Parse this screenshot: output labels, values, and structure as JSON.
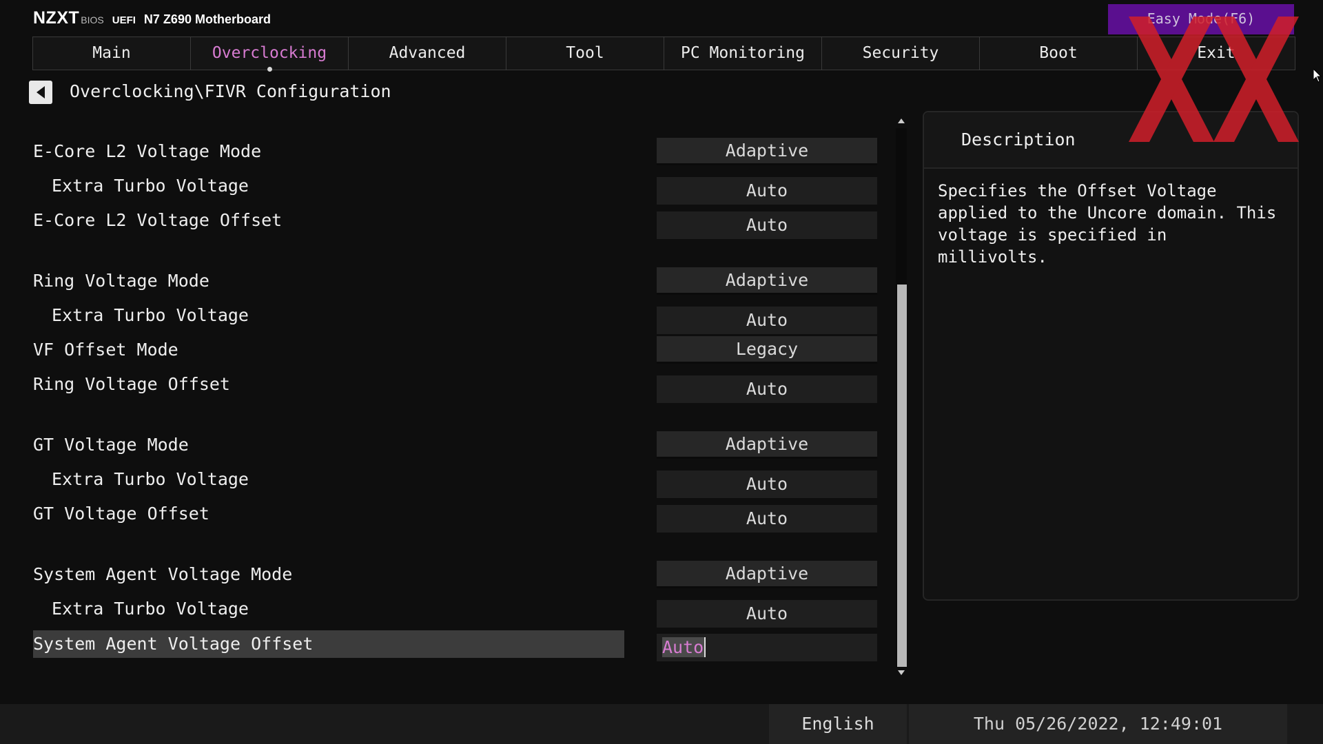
{
  "header": {
    "logo": "NZXT",
    "bios_label": "BIOS",
    "uefi_label": "UEFI",
    "board_name": "N7 Z690 Motherboard",
    "easy_mode": "Easy Mode(F6)"
  },
  "tabs": [
    {
      "label": "Main"
    },
    {
      "label": "Overclocking",
      "active": true
    },
    {
      "label": "Advanced"
    },
    {
      "label": "Tool"
    },
    {
      "label": "PC Monitoring"
    },
    {
      "label": "Security"
    },
    {
      "label": "Boot"
    },
    {
      "label": "Exit"
    }
  ],
  "breadcrumb": "Overclocking\\FIVR Configuration",
  "settings": [
    {
      "label": "E-Core L2 Voltage Mode",
      "value": "Adaptive"
    },
    {
      "label": "Extra Turbo Voltage",
      "value": "Auto"
    },
    {
      "label": "E-Core L2 Voltage Offset",
      "value": "Auto"
    },
    {
      "label": "Ring Voltage Mode",
      "value": "Adaptive"
    },
    {
      "label": "Extra Turbo Voltage",
      "value": "Auto"
    },
    {
      "label": "VF Offset Mode",
      "value": "Legacy"
    },
    {
      "label": "Ring Voltage Offset",
      "value": "Auto"
    },
    {
      "label": "GT Voltage Mode",
      "value": "Adaptive"
    },
    {
      "label": "Extra Turbo Voltage",
      "value": "Auto"
    },
    {
      "label": "GT Voltage Offset",
      "value": "Auto"
    },
    {
      "label": "System Agent Voltage Mode",
      "value": "Adaptive"
    },
    {
      "label": "Extra Turbo Voltage",
      "value": "Auto"
    },
    {
      "label": "System Agent Voltage Offset",
      "value": "Auto",
      "selected": true
    }
  ],
  "scrollbar": {
    "position_fraction": 0.29,
    "visible_fraction": 0.71
  },
  "description": {
    "title": "Description",
    "text": "Specifies the Offset Voltage applied to the Uncore domain. This voltage is specified in millivolts."
  },
  "footer": {
    "language": "English",
    "datetime": "Thu 05/26/2022, 12:49:01"
  },
  "icons": {
    "back": "left-triangle-icon",
    "scroll_up": "triangle-up-icon",
    "scroll_down": "triangle-down-icon",
    "cursor": "mouse-pointer-icon",
    "watermark": "xx-watermark-icon"
  },
  "colors": {
    "accent": "#d87cd2",
    "easy_mode_bg": "#5a0f8f",
    "watermark": "#d01f2a"
  }
}
